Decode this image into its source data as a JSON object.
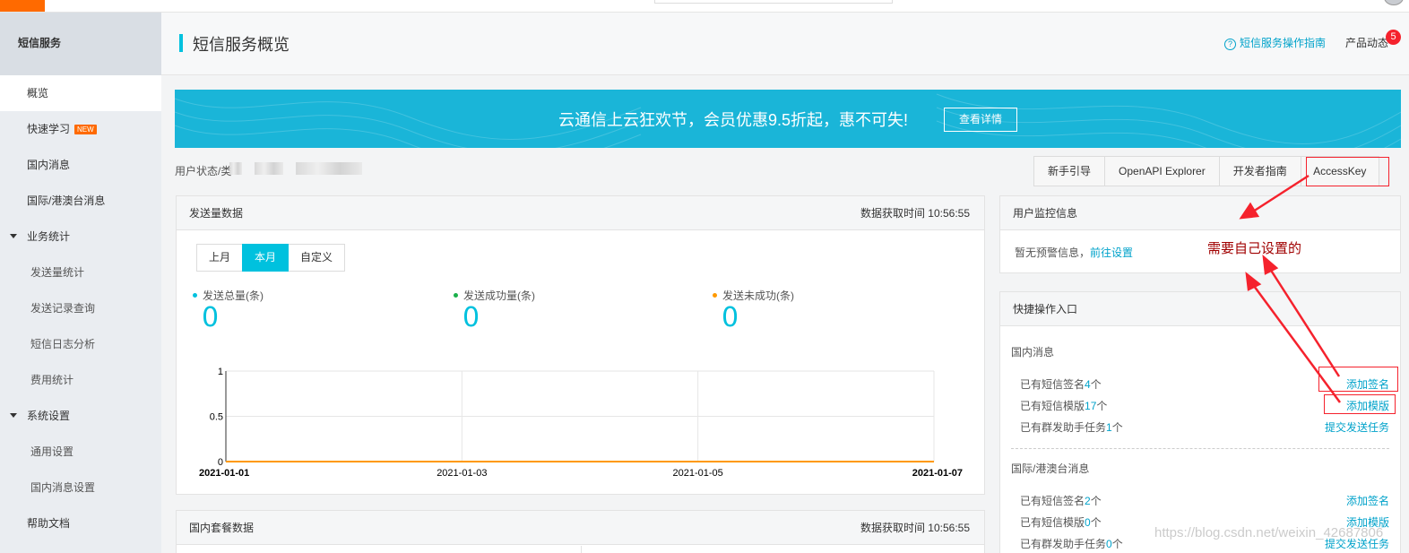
{
  "sidebar": {
    "header": "短信服务",
    "items": {
      "overview": "概览",
      "quick_learn": "快速学习",
      "quick_learn_badge": "NEW",
      "domestic": "国内消息",
      "intl": "国际/港澳台消息",
      "biz_stats": "业务统计",
      "send_stats": "发送量统计",
      "send_records": "发送记录查询",
      "log_analysis": "短信日志分析",
      "cost_stats": "费用统计",
      "sys_settings": "系统设置",
      "general_settings": "通用设置",
      "domestic_settings": "国内消息设置",
      "help_docs": "帮助文档"
    }
  },
  "header": {
    "title": "短信服务概览",
    "guide_link": "短信服务操作指南",
    "product_news": "产品动态",
    "news_count": "5"
  },
  "banner": {
    "text": "云通信上云狂欢节，会员优惠9.5折起，惠不可失!",
    "button": "查看详情"
  },
  "user_status": {
    "label": "用户状态/类"
  },
  "top_buttons": [
    "新手引导",
    "OpenAPI Explorer",
    "开发者指南",
    "AccessKey"
  ],
  "send_panel": {
    "title": "发送量数据",
    "time": "数据获取时间 10:56:55",
    "tabs": [
      "上月",
      "本月",
      "自定义"
    ],
    "metrics": [
      {
        "label": "发送总量(条)",
        "value": "0",
        "color": "#00c1de"
      },
      {
        "label": "发送成功量(条)",
        "value": "0",
        "color": "#1ab04a"
      },
      {
        "label": "发送未成功(条)",
        "value": "0",
        "color": "#ff9900"
      }
    ]
  },
  "chart_data": {
    "type": "line",
    "x": [
      "2021-01-01",
      "2021-01-03",
      "2021-01-05",
      "2021-01-07"
    ],
    "yticks": [
      "1",
      "0.5",
      "0"
    ],
    "ylim": [
      0,
      1
    ],
    "series": [
      {
        "values": [
          0,
          0,
          0,
          0
        ],
        "color": "#1ab04a"
      },
      {
        "values": [
          0,
          0,
          0,
          0
        ],
        "color": "#ff9900"
      }
    ],
    "grid": true
  },
  "package_panel": {
    "title": "国内套餐数据",
    "time": "数据获取时间 10:56:55"
  },
  "monitor_panel": {
    "title": "用户监控信息",
    "text": "暂无预警信息，",
    "link": "前往设置"
  },
  "quick_panel": {
    "title": "快捷操作入口",
    "domestic": {
      "title": "国内消息",
      "sign_prefix": "已有短信签名",
      "sign_count": "4",
      "sign_suffix": "个",
      "tpl_prefix": "已有短信模版",
      "tpl_count": "17",
      "tpl_suffix": "个",
      "task_prefix": "已有群发助手任务",
      "task_count": "1",
      "task_suffix": "个",
      "add_sign": "添加签名",
      "add_tpl": "添加模版",
      "submit_task": "提交发送任务"
    },
    "intl": {
      "title": "国际/港澳台消息",
      "sign_prefix": "已有短信签名",
      "sign_count": "2",
      "sign_suffix": "个",
      "tpl_prefix": "已有短信模版",
      "tpl_count": "0",
      "tpl_suffix": "个",
      "task_prefix": "已有群发助手任务",
      "task_count": "0",
      "task_suffix": "个",
      "add_sign": "添加签名",
      "add_tpl": "添加模版",
      "submit_task": "提交发送任务"
    }
  },
  "annotation": "需要自己设置的",
  "watermark": "https://blog.csdn.net/weixin_42687806"
}
